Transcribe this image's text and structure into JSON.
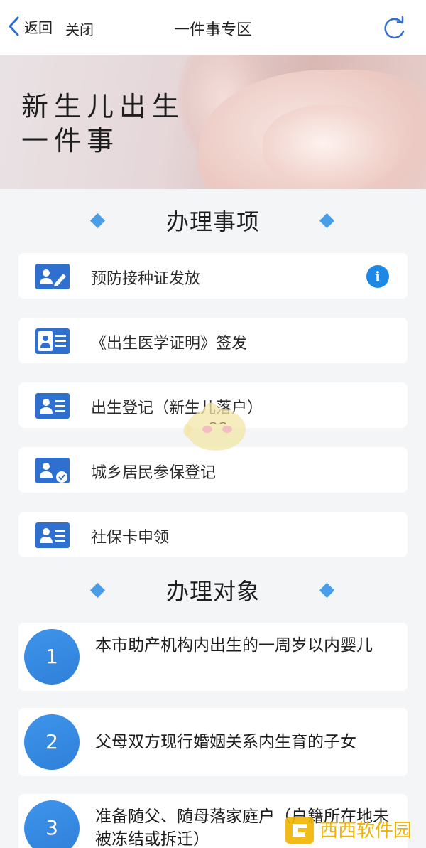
{
  "navbar": {
    "back_label": "返回",
    "close_label": "关闭",
    "title": "一件事专区"
  },
  "banner": {
    "title_line1": "新生儿出生",
    "title_line2": "一件事"
  },
  "section_items": {
    "title": "办理事项",
    "items": [
      {
        "label": "预防接种证发放",
        "icon": "id-card-pen-icon",
        "has_info": true
      },
      {
        "label": "《出生医学证明》签发",
        "icon": "id-card-person-icon",
        "has_info": false
      },
      {
        "label": "出生登记（新生儿落户）",
        "icon": "id-card-icon",
        "has_info": false
      },
      {
        "label": "城乡居民参保登记",
        "icon": "id-card-check-icon",
        "has_info": false
      },
      {
        "label": "社保卡申领",
        "icon": "id-card-icon",
        "has_info": false
      }
    ]
  },
  "section_targets": {
    "title": "办理对象",
    "items": [
      {
        "number": "1",
        "text": "本市助产机构内出生的一周岁以内婴儿"
      },
      {
        "number": "2",
        "text": "父母双方现行婚姻关系内生育的子女"
      },
      {
        "number": "3",
        "text": "准备随父、随母落家庭户（户籍所在地未被冻结或拆迁）"
      }
    ]
  },
  "watermark": {
    "brand": "西西软件园"
  },
  "colors": {
    "accent": "#1e88e5",
    "icon_blue": "#2f6fd0",
    "diamond": "#4a9ee8"
  }
}
